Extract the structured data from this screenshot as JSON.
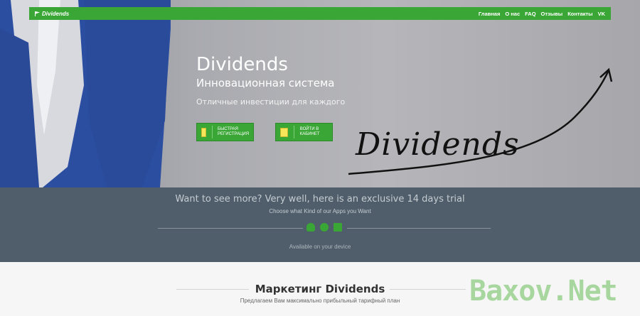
{
  "navbar": {
    "logo_text": "Dividends",
    "items": [
      "Главная",
      "О нас",
      "FAQ",
      "Отзывы",
      "Контакты",
      "VK"
    ]
  },
  "hero": {
    "title": "Dividends",
    "subtitle": "Инновационная система",
    "tagline": "Отличные инвестиции для каждого",
    "register_label": "Быстрая регистрация",
    "login_label": "Войти в кабинет",
    "script_text": "Dividends"
  },
  "trial": {
    "headline": "Want to see more? Very well, here is an exclusive 14 days trial",
    "subline": "Choose what Kind of our Apps you Want",
    "footer": "Available on your device"
  },
  "marketing": {
    "title": "Маркетинг Dividends",
    "subtitle": "Предлагаем Вам максимально прибыльный тарифный план"
  },
  "watermark": "Baxov.Net",
  "colors": {
    "accent": "#3aa636",
    "band": "#4f5e6a",
    "suit": "#2b4fa3"
  }
}
